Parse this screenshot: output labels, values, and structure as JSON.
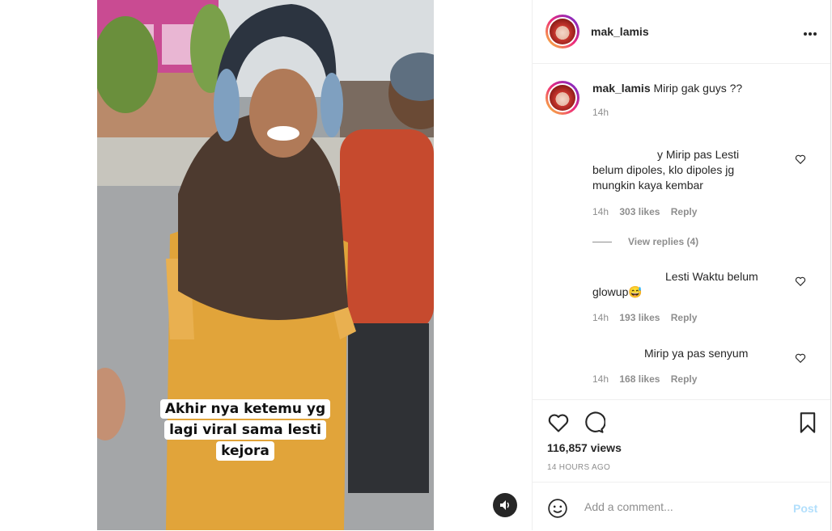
{
  "post": {
    "username": "mak_lamis",
    "more_icon": "more-horizontal-icon",
    "video_caption_lines": [
      "Akhir nya ketemu yg",
      "lagi viral sama lesti",
      "kejora"
    ],
    "audio_icon": "volume-icon"
  },
  "caption": {
    "username": "mak_lamis",
    "text": "Mirip gak guys ??",
    "time": "14h"
  },
  "comments": [
    {
      "line1": "y Mirip pas Lesti",
      "line2": "belum dipoles, klo dipoles jg",
      "line3": "mungkin kaya kembar",
      "time": "14h",
      "likes": "303 likes",
      "reply": "Reply"
    },
    {
      "line1": "Lesti Waktu belum",
      "line2": "glowup😅",
      "time": "14h",
      "likes": "193 likes",
      "reply": "Reply"
    },
    {
      "line1": "Mirip ya pas senyum",
      "time": "14h",
      "likes": "168 likes",
      "reply": "Reply"
    }
  ],
  "view_replies": "View replies (4)",
  "stats": {
    "views": "116,857 views",
    "time_ago": "14 HOURS AGO"
  },
  "add_comment": {
    "placeholder": "Add a comment...",
    "post_label": "Post"
  },
  "colors": {
    "post_disabled": "#b2dffc",
    "meta_gray": "#8e8e8e",
    "text": "#262626"
  }
}
